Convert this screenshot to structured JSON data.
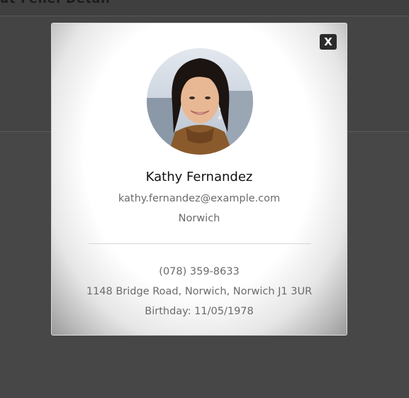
{
  "background": {
    "header_title": "ut Fenel Detail"
  },
  "modal": {
    "close_label": "X",
    "name": "Kathy Fernandez",
    "email": "kathy.fernandez@example.com",
    "city": "Norwich",
    "phone": "(078) 359-8633",
    "address": "1148 Bridge Road, Norwich, Norwich J1 3UR",
    "birthday": "Birthday: 11/05/1978"
  },
  "colors": {
    "overlay": "#474747",
    "close_button": "#2b2b2b",
    "name_text": "#111111",
    "secondary_text": "#6b6b6b"
  }
}
